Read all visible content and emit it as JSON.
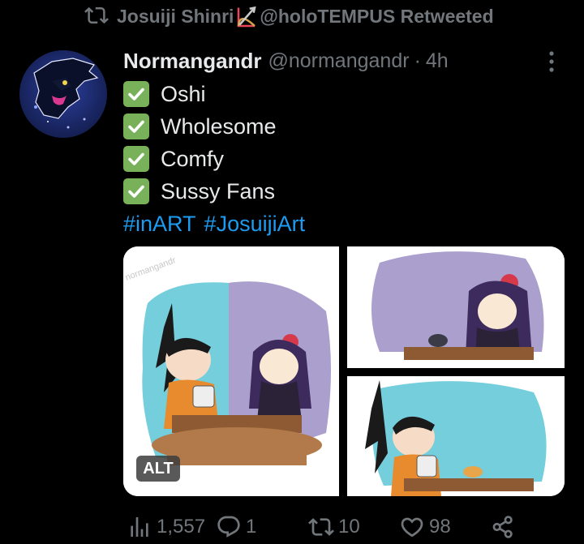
{
  "retweet": {
    "label_prefix": "Josuiji Shinri",
    "label_suffix": "@holoTEMPUS Retweeted",
    "icon": "retweet-icon"
  },
  "tweet": {
    "display_name": "Normangandr",
    "handle": "@normangandr",
    "separator": "·",
    "time": "4h",
    "lines": [
      "Oshi",
      "Wholesome",
      "Comfy",
      "Sussy Fans"
    ],
    "hashtags": [
      "#inART",
      "#JosuijiArt"
    ]
  },
  "media": {
    "alt_label": "ALT",
    "watermark": "normangandr"
  },
  "actions": {
    "views": "1,557",
    "replies": "1",
    "retweets": "10",
    "likes": "98"
  },
  "colors": {
    "background": "#000000",
    "text": "#e7e9ea",
    "muted": "#71767b",
    "link": "#1d9bf0",
    "check": "#78b159"
  }
}
